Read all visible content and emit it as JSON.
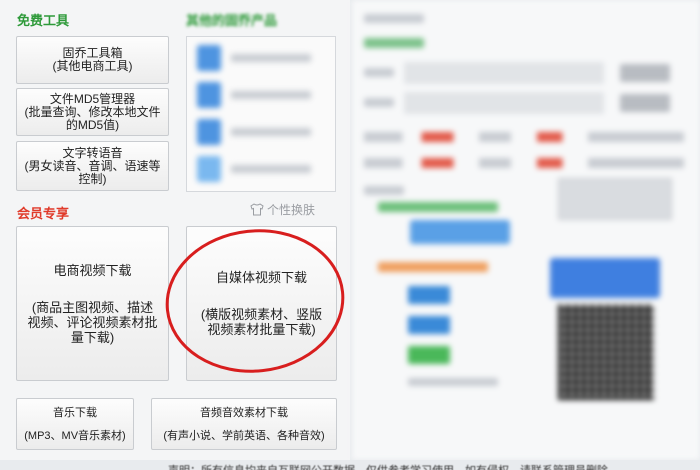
{
  "free_tools": {
    "title": "免费工具",
    "buttons": [
      {
        "line1": "固乔工具箱",
        "line2": "(其他电商工具)"
      },
      {
        "line1": "文件MD5管理器",
        "line2": "(批量查询、修改本地文件",
        "line3": "的MD5值)"
      },
      {
        "line1": "文字转语音",
        "line2": "(男女读音、音调、语速等",
        "line3": "控制)"
      }
    ]
  },
  "other_products": {
    "title": "其他的固乔产品"
  },
  "member": {
    "title": "会员专享",
    "skin_button": "个性换肤",
    "ecom_video": {
      "title": "电商视频下载",
      "line1": "(商品主图视频、描述",
      "line2": "视频、评论视频素材批",
      "line3": "量下载)"
    },
    "media_video": {
      "title": "自媒体视频下载",
      "line1": "(横版视频素材、竖版",
      "line2": "视频素材批量下载)"
    },
    "music": {
      "title": "音乐下载",
      "sub": "(MP3、MV音乐素材)"
    },
    "sfx": {
      "title": "音频音效素材下载",
      "sub": "(有声小说、学前英语、各种音效)"
    }
  },
  "footer": {
    "text": "声明：所有信息均来自互联网公开数据，仅供参考学习使用，如有侵权，请联系管理员删除"
  },
  "colors": {
    "green": "#2e9a3a",
    "red": "#e03a2a",
    "circle": "#d81e1e",
    "blue": "#4e94e0"
  }
}
